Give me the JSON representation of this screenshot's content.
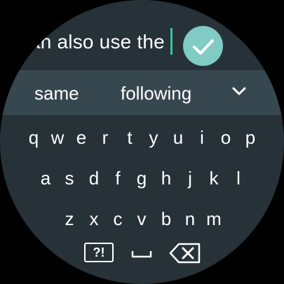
{
  "input": {
    "text": "an also use the"
  },
  "suggestions": {
    "left": "same",
    "center": "following"
  },
  "keyboard": {
    "row1": [
      "q",
      "w",
      "e",
      "r",
      "t",
      "y",
      "u",
      "i",
      "o",
      "p"
    ],
    "row2": [
      "a",
      "s",
      "d",
      "f",
      "g",
      "h",
      "j",
      "k",
      "l"
    ],
    "row3": [
      "z",
      "x",
      "c",
      "v",
      "b",
      "n",
      "m"
    ],
    "symbols_key": "?!"
  },
  "colors": {
    "background": "#263238",
    "suggestion_bar": "#37474f",
    "accent": "#80cbc4",
    "cursor": "#3ac2a8"
  },
  "icons": {
    "confirm": "check-icon",
    "expand": "chevron-down-icon",
    "space": "space-bar-icon",
    "delete": "backspace-icon"
  }
}
